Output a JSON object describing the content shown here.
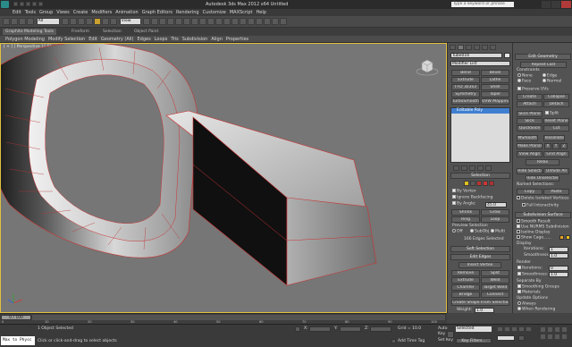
{
  "app": {
    "title": "Autodesk 3ds Max 2012 x64    Untitled",
    "search_placeholder": "Type a keyword or phrase"
  },
  "menu": [
    "Edit",
    "Tools",
    "Group",
    "Views",
    "Create",
    "Modifiers",
    "Animation",
    "Graph Editors",
    "Rendering",
    "Customize",
    "MAXScript",
    "Help"
  ],
  "toolbar": {
    "selection_filter": "All",
    "view_dropdown": "View"
  },
  "ribbon": {
    "tabs": [
      "Graphite Modeling Tools",
      "Freeform",
      "Selection",
      "Object Paint"
    ],
    "tools": [
      "Polygon Modeling",
      "Modify Selection",
      "Edit",
      "Geometry (All)",
      "Edges",
      "Loops",
      "Tris",
      "Subdivision",
      "Align",
      "Properties"
    ]
  },
  "viewport": {
    "label": "[ + ] [ Perspective ] [ Shaded + Edged Faces ]"
  },
  "modify_panel": {
    "object_name": "Tube016",
    "modifier_list": "Modifier List",
    "buttons": [
      [
        "Bend",
        "Bevel"
      ],
      [
        "Extrude",
        "Lathe"
      ],
      [
        "FFD 3x3x3",
        "Shell"
      ],
      [
        "Symmetry",
        "Taper"
      ],
      [
        "TurboSmooth",
        "UVW Mapping"
      ]
    ],
    "stack": [
      "Editable Poly"
    ]
  },
  "selection": {
    "header": "Selection",
    "by_vertex": "By Vertex",
    "ignore_backfacing": "Ignore Backfacing",
    "by_angle": "By Angle:",
    "by_angle_value": "45.0",
    "buttons": [
      [
        "Shrink",
        "Grow"
      ],
      [
        "Ring",
        "Loop"
      ]
    ],
    "preview": "Preview Selection",
    "preview_options": [
      "Off",
      "SubObj",
      "Multi"
    ],
    "status": "166 Edges Selected"
  },
  "soft_selection": {
    "header": "Soft Selection"
  },
  "edit_edges": {
    "header": "Edit Edges",
    "insert_vertex": "Insert Vertex",
    "rows": [
      [
        "Remove",
        "Split"
      ],
      [
        "Extrude",
        "Weld"
      ],
      [
        "Chamfer",
        "Target Weld"
      ],
      [
        "Bridge",
        "Connect"
      ]
    ],
    "create_shape": "Create Shape From Selection",
    "weight_label": "Weight:",
    "weight": "1.0",
    "crease_label": "Crease:",
    "crease": "0.0"
  },
  "edit_geometry": {
    "header": "Edit Geometry",
    "repeat_last": "Repeat Last",
    "constraints": "Constraints",
    "constraint_options": [
      [
        "None",
        "Edge"
      ],
      [
        "Face",
        "Normal"
      ]
    ],
    "preserve_uvs": "Preserve UVs",
    "rows": [
      [
        "Create",
        "Collapse"
      ],
      [
        "Attach",
        "Detach"
      ]
    ],
    "slice_plane": "Slice Plane",
    "split": "Split",
    "rows2": [
      [
        "Slice",
        "Reset Plane"
      ],
      [
        "QuickSlice",
        "Cut"
      ]
    ],
    "msmooth": "MSmooth",
    "tessellate": "Tessellate",
    "make_planar": "Make Planar",
    "xyz": [
      "X",
      "Y",
      "Z"
    ],
    "rows3": [
      [
        "View Align",
        "Grid Align"
      ]
    ],
    "relax": "Relax",
    "hide_rows": [
      [
        "Hide Selected",
        "Unhide All"
      ]
    ],
    "hide_unselected": "Hide Unselected",
    "named_selections": "Named Selections:",
    "copy_paste": [
      "Copy",
      "Paste"
    ],
    "delete_isolated": "Delete Isolated Vertices",
    "full_interactivity": "Full Interactivity"
  },
  "subdivision_surface": {
    "header": "Subdivision Surface",
    "smooth_result": "Smooth Result",
    "use_nurms": "Use NURMS Subdivision",
    "isoline": "Isoline Display",
    "show_cage": "Show Cage......",
    "display": "Display",
    "iterations_label": "Iterations:",
    "iterations": "1",
    "smoothness_label": "Smoothness:",
    "smoothness": "1.0",
    "render": "Render",
    "render_iterations": "0",
    "render_smoothness": "1.0",
    "separate_by": "Separate By",
    "smoothing_groups": "Smoothing Groups",
    "materials": "Materials",
    "update_options": "Update Options",
    "update_choices": [
      "Always",
      "When Rendering",
      "Manually"
    ]
  },
  "timeline": {
    "frame": "0 / 100",
    "ticks": [
      "0",
      "10",
      "20",
      "30",
      "40",
      "50",
      "60",
      "70",
      "80",
      "90",
      "100"
    ]
  },
  "status": {
    "maxscript": "Max to Physc",
    "selected": "1 Object Selected",
    "prompt": "Click or click-and-drag to select objects",
    "x_label": "X:",
    "y_label": "Y:",
    "z_label": "Z:",
    "grid": "Grid = 10.0",
    "auto_key": "Auto Key",
    "selected_dropdown": "Selected",
    "set_key": "Set Key",
    "key_filters": "Key Filters...",
    "add_time_tag": "Add Time Tag"
  },
  "colors": {
    "accent": "#e0c040",
    "panel": "#535353",
    "viewport": "#767676",
    "selected_row": "#3f7fd0"
  }
}
